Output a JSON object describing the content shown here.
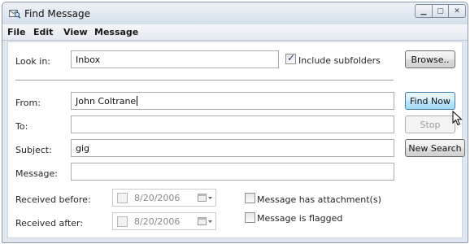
{
  "window": {
    "title": "Find Message"
  },
  "menu": [
    "File",
    "Edit",
    "View",
    "Message"
  ],
  "colors": {
    "accent_border": "#3c7fb1",
    "disabled_text": "#9a9a9a",
    "titlebar": "#dfe7ef"
  },
  "look_in": {
    "label": "Look in:",
    "value": "Inbox",
    "include_subfolders_label": "Include subfolders",
    "include_subfolders_checked": true
  },
  "fields": {
    "from": {
      "label": "From:",
      "value": "John Coltrane"
    },
    "to": {
      "label": "To:",
      "value": ""
    },
    "subject": {
      "label": "Subject:",
      "value": "gig"
    },
    "message": {
      "label": "Message:",
      "value": ""
    }
  },
  "received_before": {
    "label": "Received before:",
    "date": "8/20/2006",
    "enabled": false
  },
  "received_after": {
    "label": "Received after:",
    "date": "8/20/2006",
    "enabled": false
  },
  "options": {
    "has_attachment": {
      "label": "Message has attachment(s)",
      "checked": false
    },
    "is_flagged": {
      "label": "Message is flagged",
      "checked": false
    }
  },
  "buttons": {
    "browse": "Browse..",
    "find_now": "Find Now",
    "stop": "Stop",
    "new_search": "New Search"
  },
  "icons": [
    "find-message-icon",
    "minimize-icon",
    "maximize-icon",
    "close-icon",
    "calendar-icon",
    "mouse-pointer-icon"
  ]
}
